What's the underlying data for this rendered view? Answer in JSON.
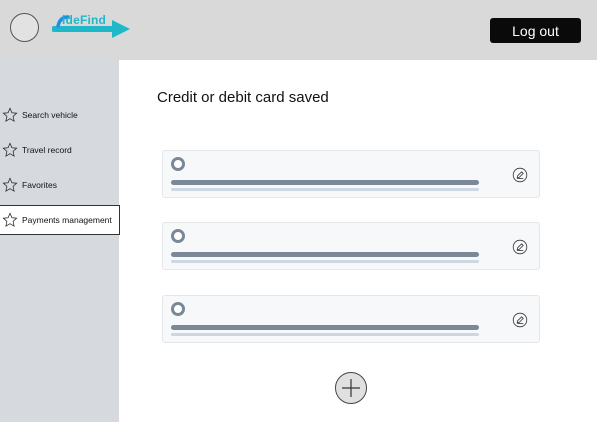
{
  "header": {
    "logo_text": "ideFind",
    "logout_label": "Log out",
    "brand_color": "#1fb8c9"
  },
  "sidebar": {
    "items": [
      {
        "label": "Search vehicle",
        "icon": "star-icon"
      },
      {
        "label": "Travel record",
        "icon": "star-icon"
      },
      {
        "label": "Favorites",
        "icon": "star-icon"
      },
      {
        "label": "Payments management",
        "icon": "star-icon",
        "active": true
      }
    ]
  },
  "main": {
    "title": "Credit or debit card saved",
    "cards": [
      {
        "icon": "edit-icon"
      },
      {
        "icon": "edit-icon"
      },
      {
        "icon": "edit-icon"
      }
    ],
    "add_icon": "plus-icon"
  }
}
